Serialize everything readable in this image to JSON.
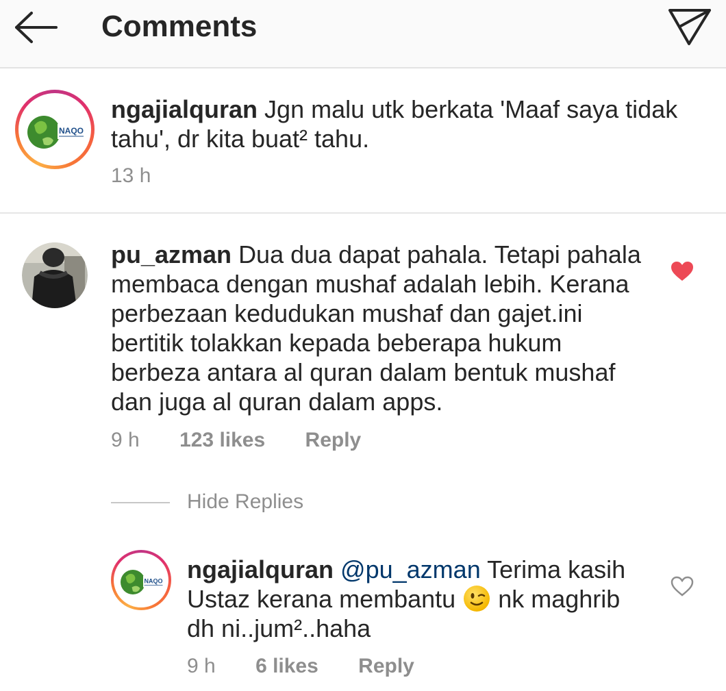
{
  "header": {
    "title": "Comments",
    "back_icon": "arrow-left-icon",
    "share_icon": "paper-plane-icon"
  },
  "caption": {
    "username": "ngajialquran",
    "text": "Jgn malu utk berkata 'Maaf saya tidak tahu', dr kita buat² tahu.",
    "time": "13 h",
    "avatar_logo_text": "NAQO"
  },
  "comments": [
    {
      "username": "pu_azman",
      "text": "Dua dua dapat pahala. Tetapi pahala membaca dengan mushaf adalah lebih.  Kerana perbezaan kedudukan mushaf dan gajet.ini bertitik tolakkan kepada beberapa hukum berbeza antara al quran dalam bentuk mushaf dan juga al quran dalam apps.",
      "time": "9 h",
      "likes": "123 likes",
      "reply_label": "Reply",
      "liked": true,
      "like_color": "#ed4956",
      "hide_replies_label": "Hide Replies",
      "replies": [
        {
          "username": "ngajialquran",
          "mention": "@pu_azman",
          "text_before_emoji": "Terima kasih Ustaz kerana membantu",
          "emoji": "winking-face-emoji",
          "text_after_emoji": "nk maghrib dh ni..jum²..haha",
          "time": "9 h",
          "likes": "6 likes",
          "reply_label": "Reply",
          "liked": false
        }
      ]
    }
  ],
  "colors": {
    "text": "#262626",
    "secondary": "#8e8e8e",
    "mention": "#00376b",
    "like": "#ed4956",
    "header_bg": "#fafafa"
  }
}
